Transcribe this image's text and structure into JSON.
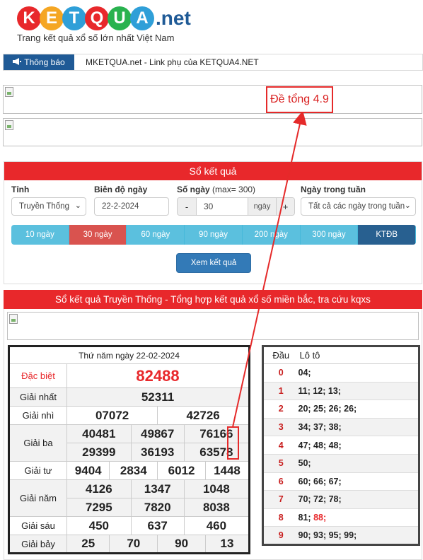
{
  "logo": {
    "letters": [
      "K",
      "E",
      "T",
      "Q",
      "U",
      "A"
    ],
    "suffix": ".net",
    "tagline": "Trang kết quả xổ số lớn nhất Việt Nam"
  },
  "notice": {
    "label": "Thông báo",
    "icon": "megaphone-icon",
    "text": "MKETQUA.net - Link phụ của KETQUA4.NET"
  },
  "annotation": {
    "text": "Đề tổng 4.9",
    "color": "#e52a2a"
  },
  "search": {
    "title": "Sổ kết quả",
    "province": {
      "label": "Tỉnh",
      "value": "Truyền Thống"
    },
    "range": {
      "label": "Biên độ ngày",
      "value": "22-2-2024"
    },
    "days": {
      "label": "Số ngày",
      "label_note": "(max= 300)",
      "minus": "-",
      "value": "30",
      "unit": "ngày",
      "plus": "+"
    },
    "weekday": {
      "label": "Ngày trong tuần",
      "value": "Tất cả các ngày trong tuần"
    },
    "quick_ranges": [
      "10 ngày",
      "30 ngày",
      "60 ngày",
      "90 ngày",
      "200 ngày",
      "300 ngày",
      "KTĐB"
    ],
    "active_range": "30 ngày",
    "view_button": "Xem kết quả"
  },
  "results": {
    "title": "Sổ kết quả Truyền Thống - Tổng hợp kết quả xổ số miền bắc, tra cứu kqxs",
    "date": "Thứ năm ngày 22-02-2024",
    "prizes": {
      "special": {
        "label": "Đặc biệt",
        "numbers": [
          "82488"
        ]
      },
      "first": {
        "label": "Giải nhất",
        "numbers": [
          "52311"
        ]
      },
      "second": {
        "label": "Giải nhì",
        "numbers": [
          "07072",
          "42726"
        ]
      },
      "third": {
        "label": "Giải ba",
        "numbers": [
          "40481",
          "49867",
          "76166",
          "29399",
          "36193",
          "63578"
        ]
      },
      "fourth": {
        "label": "Giải tư",
        "numbers": [
          "9404",
          "2834",
          "6012",
          "1448"
        ]
      },
      "fifth": {
        "label": "Giải năm",
        "numbers": [
          "4126",
          "1347",
          "1048",
          "7295",
          "7820",
          "8038"
        ]
      },
      "sixth": {
        "label": "Giải sáu",
        "numbers": [
          "450",
          "637",
          "460"
        ]
      },
      "seventh": {
        "label": "Giải bảy",
        "numbers": [
          "25",
          "70",
          "90",
          "13"
        ]
      }
    },
    "loto": {
      "headers": [
        "Đầu",
        "Lô tô"
      ],
      "rows": [
        {
          "head": "0",
          "values": "04;"
        },
        {
          "head": "1",
          "values": "11; 12; 13;"
        },
        {
          "head": "2",
          "values": "20; 25; 26; 26;"
        },
        {
          "head": "3",
          "values": "34; 37; 38;"
        },
        {
          "head": "4",
          "values": "47; 48; 48;"
        },
        {
          "head": "5",
          "values": "50;"
        },
        {
          "head": "6",
          "values": "60; 66; 67;"
        },
        {
          "head": "7",
          "values": "70; 72; 78;"
        },
        {
          "head": "8",
          "values": "81;",
          "highlight": "88;"
        },
        {
          "head": "9",
          "values": "90; 93; 95; 99;"
        }
      ]
    }
  }
}
